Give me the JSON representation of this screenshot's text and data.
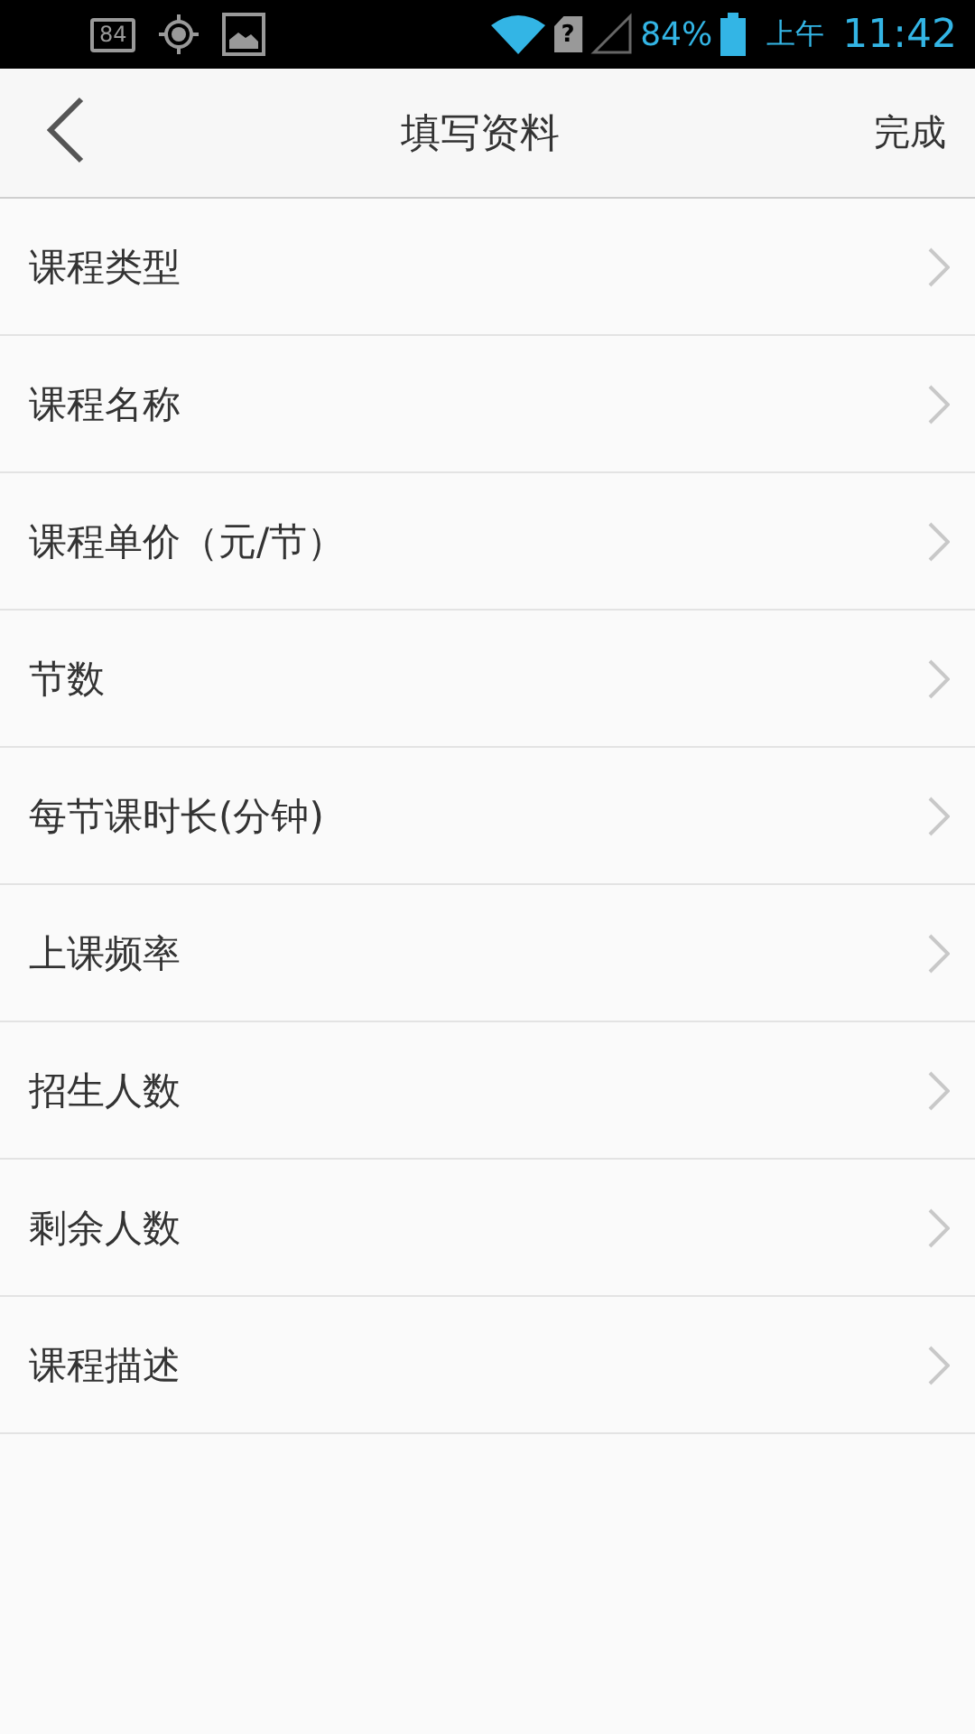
{
  "status_bar": {
    "notification_badge": "84",
    "sim_mark": "?",
    "battery_percent": "84%",
    "period": "上午",
    "time": "11:42"
  },
  "nav_bar": {
    "title": "填写资料",
    "action": "完成"
  },
  "items": [
    {
      "label": "课程类型"
    },
    {
      "label": "课程名称"
    },
    {
      "label": "课程单价（元/节）"
    },
    {
      "label": "节数"
    },
    {
      "label": "每节课时长(分钟)"
    },
    {
      "label": "上课频率"
    },
    {
      "label": "招生人数"
    },
    {
      "label": "剩余人数"
    },
    {
      "label": "课程描述"
    }
  ]
}
